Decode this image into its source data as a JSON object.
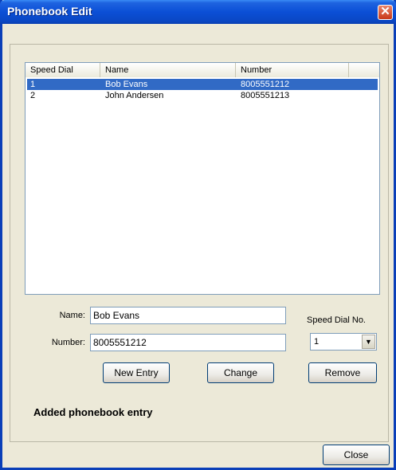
{
  "window": {
    "title": "Phonebook Edit",
    "close_glyph": "✕"
  },
  "list": {
    "columns": [
      "Speed Dial",
      "Name",
      "Number"
    ],
    "rows": [
      {
        "speed": "1",
        "name": "Bob Evans",
        "number": "8005551212",
        "selected": true
      },
      {
        "speed": "2",
        "name": "John Andersen",
        "number": "8005551213",
        "selected": false
      }
    ]
  },
  "form": {
    "name_label": "Name:",
    "name_value": "Bob Evans",
    "number_label": "Number:",
    "number_value": "8005551212",
    "speed_dial_label": "Speed Dial No.",
    "speed_dial_value": "1",
    "combo_arrow_icon": "chevron-down-icon"
  },
  "buttons": {
    "new_entry": "New Entry",
    "change": "Change",
    "remove": "Remove",
    "close": "Close"
  },
  "status_text": "Added phonebook entry",
  "colors": {
    "selection": "#316ac5",
    "titlebar": "#0b4fd6",
    "window_bg": "#ece9d8"
  }
}
